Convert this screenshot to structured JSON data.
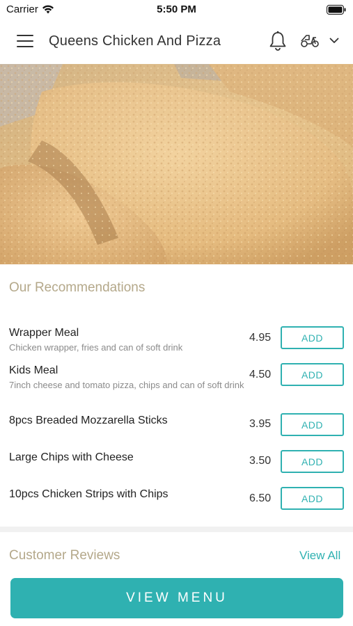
{
  "status_bar": {
    "carrier": "Carrier",
    "time": "5:50 PM"
  },
  "header": {
    "title": "Queens Chicken And Pizza"
  },
  "icons": {
    "menu": "hamburger-icon",
    "notifications": "bell-icon",
    "delivery": "scooter-icon",
    "dropdown": "chevron-down-icon"
  },
  "recommendations": {
    "title": "Our Recommendations",
    "items": [
      {
        "name": "Wrapper Meal",
        "description": "Chicken wrapper, fries and can of soft drink",
        "price": "4.95",
        "button": "ADD"
      },
      {
        "name": "Kids Meal",
        "description": "7inch cheese and tomato pizza, chips and can of soft drink",
        "price": "4.50",
        "button": "ADD"
      },
      {
        "name": "8pcs Breaded Mozzarella Sticks",
        "description": "",
        "price": "3.95",
        "button": "ADD"
      },
      {
        "name": "Large Chips with Cheese",
        "description": "",
        "price": "3.50",
        "button": "ADD"
      },
      {
        "name": "10pcs Chicken Strips with Chips",
        "description": "",
        "price": "6.50",
        "button": "ADD"
      }
    ]
  },
  "reviews": {
    "title": "Customer Reviews",
    "view_all": "View All"
  },
  "footer": {
    "view_menu": "VIEW MENU"
  },
  "colors": {
    "accent": "#2fb1b1",
    "section_heading": "#b4a88a"
  }
}
